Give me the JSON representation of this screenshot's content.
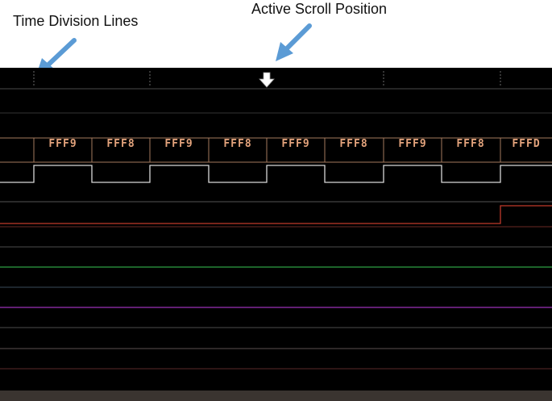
{
  "annotations": {
    "time_division": "Time Division Lines",
    "active_scroll": "Active Scroll Position"
  },
  "colors": {
    "background": "#000000",
    "bus_label": "#e3a37c",
    "clock_line": "#d8d8d8",
    "red_signal": "#c0392b",
    "green_signal": "#2ea043",
    "purple_signal": "#9b30b8",
    "arrow": "#5b9bd5"
  },
  "bus": {
    "values": [
      "FFF9",
      "FFF8",
      "FFF9",
      "FFF8",
      "FFF9",
      "FFF8",
      "FFF9",
      "FFF8",
      "FFFD"
    ]
  },
  "icons": {
    "scroll_marker": "down-arrow-icon",
    "callout_arrow": "pointer-arrow-icon"
  }
}
